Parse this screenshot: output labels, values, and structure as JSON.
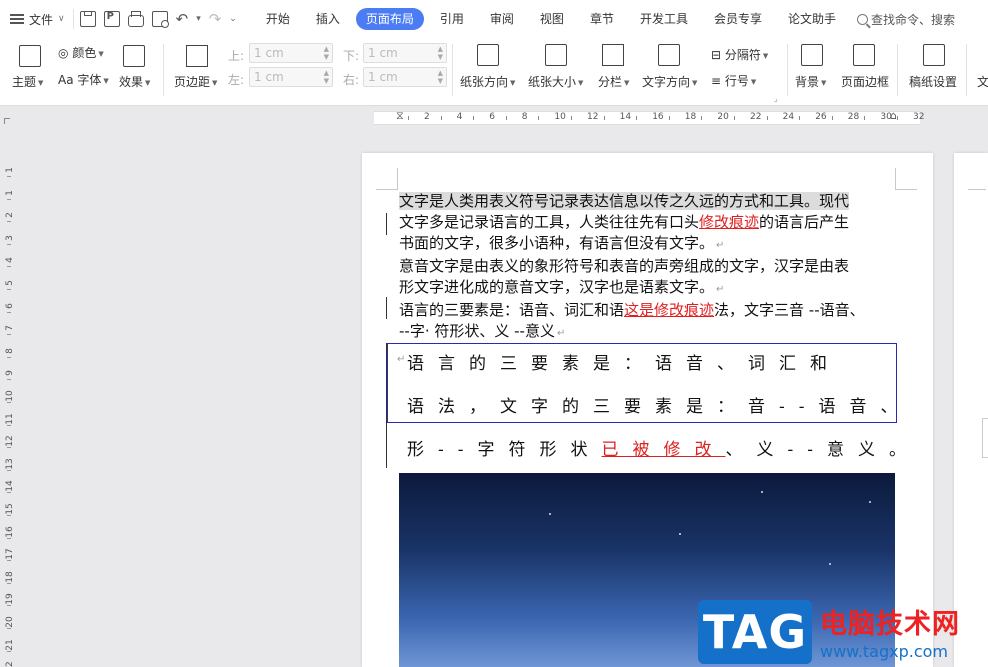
{
  "menubar": {
    "file_label": "文件",
    "tabs": [
      {
        "label": "开始"
      },
      {
        "label": "插入"
      },
      {
        "label": "页面布局"
      },
      {
        "label": "引用"
      },
      {
        "label": "审阅"
      },
      {
        "label": "视图"
      },
      {
        "label": "章节"
      },
      {
        "label": "开发工具"
      },
      {
        "label": "会员专享"
      },
      {
        "label": "论文助手"
      }
    ],
    "active_tab": "页面布局",
    "search_text": "查找命令、搜索"
  },
  "ribbon": {
    "theme": "主题",
    "colors": "颜色",
    "fonts": "字体",
    "effects": "效果",
    "margins": "页边距",
    "margin_top_label": "上:",
    "margin_top_value": "1 cm",
    "margin_bottom_label": "下:",
    "margin_bottom_value": "1 cm",
    "margin_left_label": "左:",
    "margin_left_value": "1 cm",
    "margin_right_label": "右:",
    "margin_right_value": "1 cm",
    "orientation": "纸张方向",
    "size": "纸张大小",
    "columns": "分栏",
    "text_direction": "文字方向",
    "breaks": "分隔符",
    "line_numbers": "行号",
    "background": "背景",
    "page_borders": "页面边框",
    "manuscript": "稿纸设置",
    "cut_off": "文"
  },
  "ruler": {
    "h_numbers": [
      "2",
      "4",
      "6",
      "8",
      "10",
      "12",
      "14",
      "16",
      "18",
      "20",
      "22",
      "24",
      "26",
      "28",
      "30",
      "32"
    ],
    "v_numbers": [
      "1",
      "1",
      "2",
      "3",
      "4",
      "5",
      "6",
      "7",
      "8",
      "9",
      "10",
      "11",
      "12",
      "13",
      "14",
      "15",
      "16",
      "17",
      "18",
      "19",
      "20",
      "21",
      "22"
    ]
  },
  "document": {
    "p1_hl": "文字是人类用表义符号记录表达信息以传之久远的方式和工具。现代",
    "p1_a": "文字多是记录语言的工具，人类往往先有口头",
    "p1_rev": "修改痕迹",
    "p1_b": "的语言后产生",
    "p1_c": "书面的文字，很多小语种，有语言但没有文字。",
    "p2_a": "意音文字是由表义的象形符号和表音的声旁组成的文字，汉字是由表",
    "p2_b": "形文字进化成的意音文字，汉字也是语素文字。",
    "p3_a": "语言的三要素是：语音、词汇和语",
    "p3_rev": "这是修改痕迹",
    "p3_b": "法，文字三音 --语音、",
    "p3_c": "--字· 符形状、义 --意义",
    "p4_line1": "语言的三要素是：语音、词汇和",
    "p4_line2": "语法，文字的三要素是：音--语音、",
    "p4_line3_a": "形--字符形状",
    "p4_line3_rev": "已被修改",
    "p4_line3_b": "、义--意义。",
    "para_mark": "↵"
  },
  "watermark": {
    "tag": "TAG",
    "cn": "电脑技术网",
    "url": "www.tagxp.com"
  },
  "colors": {
    "accent": "#4c7cf3",
    "revision": "#e02020",
    "box": "#2c2ca8"
  }
}
